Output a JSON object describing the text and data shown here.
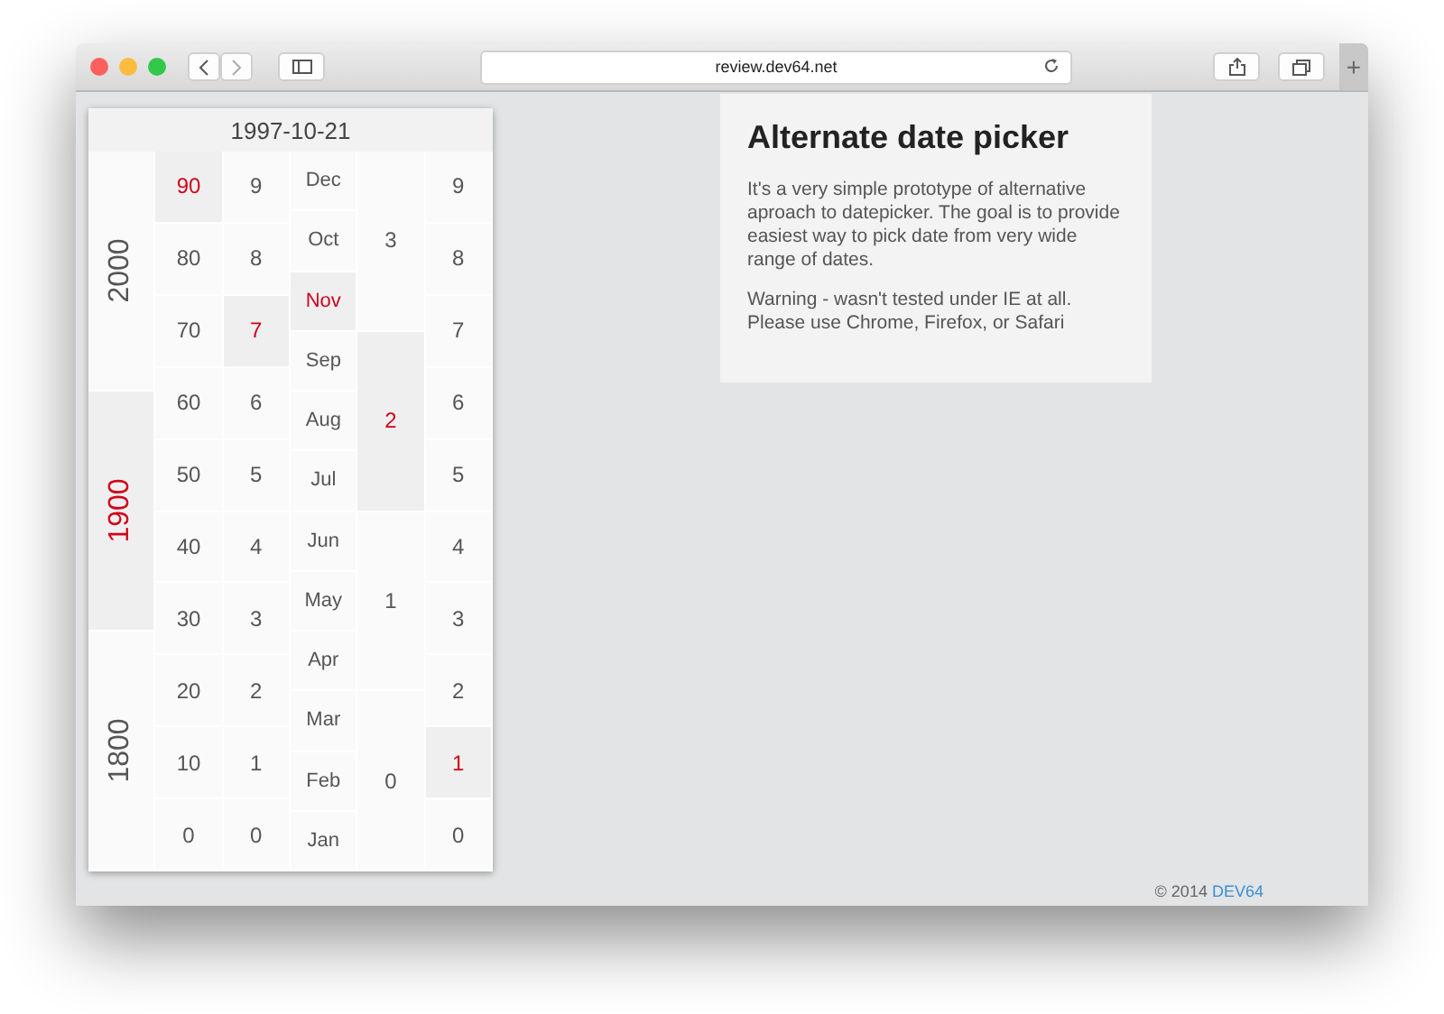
{
  "browser": {
    "address": "review.dev64.net",
    "new_tab": "+"
  },
  "picker": {
    "date": "1997-10-21",
    "columns": [
      {
        "kind": "century",
        "cells": [
          {
            "label": "2000",
            "selected": false
          },
          {
            "label": "1900",
            "selected": true
          },
          {
            "label": "1800",
            "selected": false
          }
        ]
      },
      {
        "kind": "decade",
        "cells": [
          {
            "label": "90",
            "selected": true
          },
          {
            "label": "80",
            "selected": false
          },
          {
            "label": "70",
            "selected": false
          },
          {
            "label": "60",
            "selected": false
          },
          {
            "label": "50",
            "selected": false
          },
          {
            "label": "40",
            "selected": false
          },
          {
            "label": "30",
            "selected": false
          },
          {
            "label": "20",
            "selected": false
          },
          {
            "label": "10",
            "selected": false
          },
          {
            "label": "0",
            "selected": false
          }
        ]
      },
      {
        "kind": "year",
        "cells": [
          {
            "label": "9",
            "selected": false
          },
          {
            "label": "8",
            "selected": false
          },
          {
            "label": "7",
            "selected": true
          },
          {
            "label": "6",
            "selected": false
          },
          {
            "label": "5",
            "selected": false
          },
          {
            "label": "4",
            "selected": false
          },
          {
            "label": "3",
            "selected": false
          },
          {
            "label": "2",
            "selected": false
          },
          {
            "label": "1",
            "selected": false
          },
          {
            "label": "0",
            "selected": false
          }
        ]
      },
      {
        "kind": "month",
        "cells": [
          {
            "label": "Dec",
            "selected": false
          },
          {
            "label": "Oct",
            "selected": false
          },
          {
            "label": "Nov",
            "selected": true
          },
          {
            "label": "Sep",
            "selected": false
          },
          {
            "label": "Aug",
            "selected": false
          },
          {
            "label": "Jul",
            "selected": false
          },
          {
            "label": "Jun",
            "selected": false
          },
          {
            "label": "May",
            "selected": false
          },
          {
            "label": "Apr",
            "selected": false
          },
          {
            "label": "Mar",
            "selected": false
          },
          {
            "label": "Feb",
            "selected": false
          },
          {
            "label": "Jan",
            "selected": false
          }
        ]
      },
      {
        "kind": "day_tens",
        "cells": [
          {
            "label": "3",
            "selected": false
          },
          {
            "label": "2",
            "selected": true
          },
          {
            "label": "1",
            "selected": false
          },
          {
            "label": "0",
            "selected": false
          }
        ]
      },
      {
        "kind": "day_ones",
        "cells": [
          {
            "label": "9",
            "selected": false
          },
          {
            "label": "8",
            "selected": false
          },
          {
            "label": "7",
            "selected": false
          },
          {
            "label": "6",
            "selected": false
          },
          {
            "label": "5",
            "selected": false
          },
          {
            "label": "4",
            "selected": false
          },
          {
            "label": "3",
            "selected": false
          },
          {
            "label": "2",
            "selected": false
          },
          {
            "label": "1",
            "selected": true
          },
          {
            "label": "0",
            "selected": false
          }
        ]
      }
    ]
  },
  "info": {
    "title": "Alternate date picker",
    "paragraphs": [
      "It's a very simple prototype of alternative aproach to datepicker. The goal is to provide easiest way to pick date from very wide range of dates.",
      "Warning - wasn't tested under IE at all. Please use Chrome, Firefox, or Safari"
    ]
  },
  "footer": {
    "text": "© 2014",
    "link": "DEV64"
  }
}
